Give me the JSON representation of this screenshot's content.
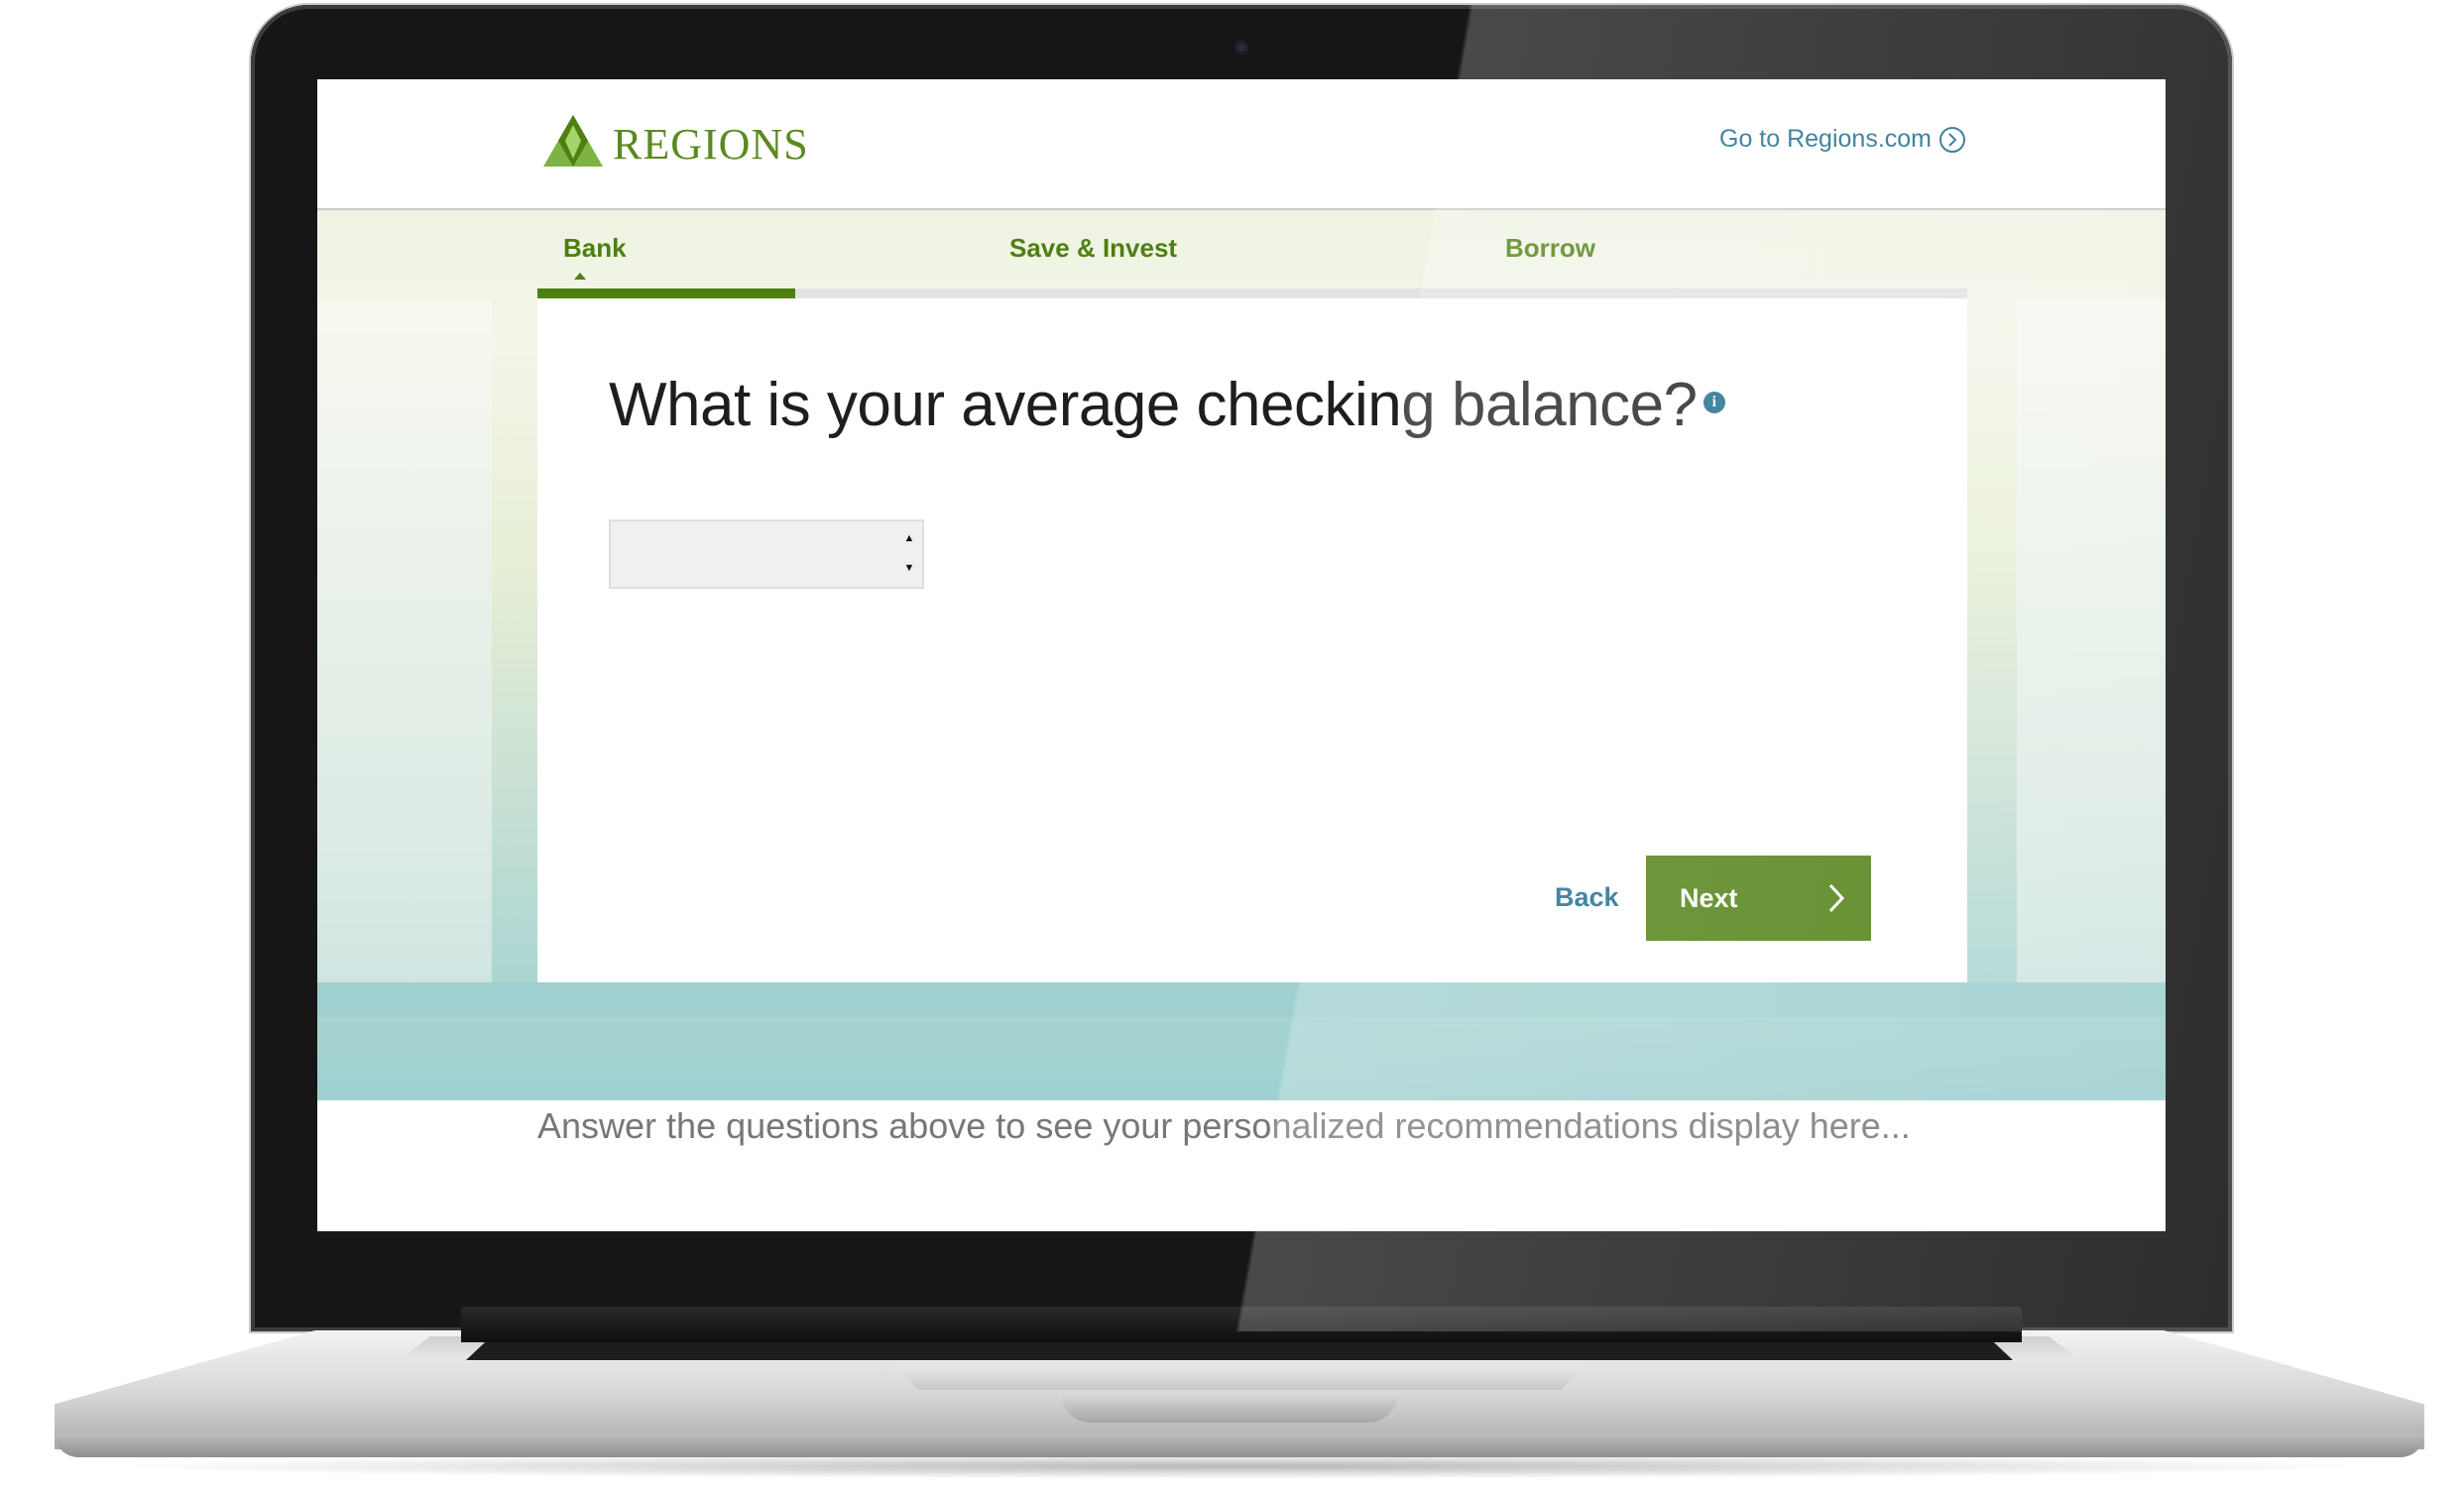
{
  "header": {
    "logo_text": "REGIONS",
    "go_link_label": "Go to Regions.com",
    "go_link_icon": "chevron-right-circle-icon"
  },
  "tabs": [
    {
      "label": "Bank",
      "active": true
    },
    {
      "label": "Save & Invest",
      "active": false
    },
    {
      "label": "Borrow",
      "active": false
    }
  ],
  "progress": {
    "fraction": 0.18
  },
  "question": {
    "text": "What is your average checking balance?",
    "info_icon": "info-icon",
    "input_value": "",
    "input_placeholder": ""
  },
  "actions": {
    "back_label": "Back",
    "next_label": "Next"
  },
  "recommendations": {
    "text": "Answer the questions above to see your personalized recommendations display here..."
  },
  "colors": {
    "brand_green": "#4e7f11",
    "link_blue": "#1a6a8a",
    "teal_band": "#9fd0cf"
  }
}
